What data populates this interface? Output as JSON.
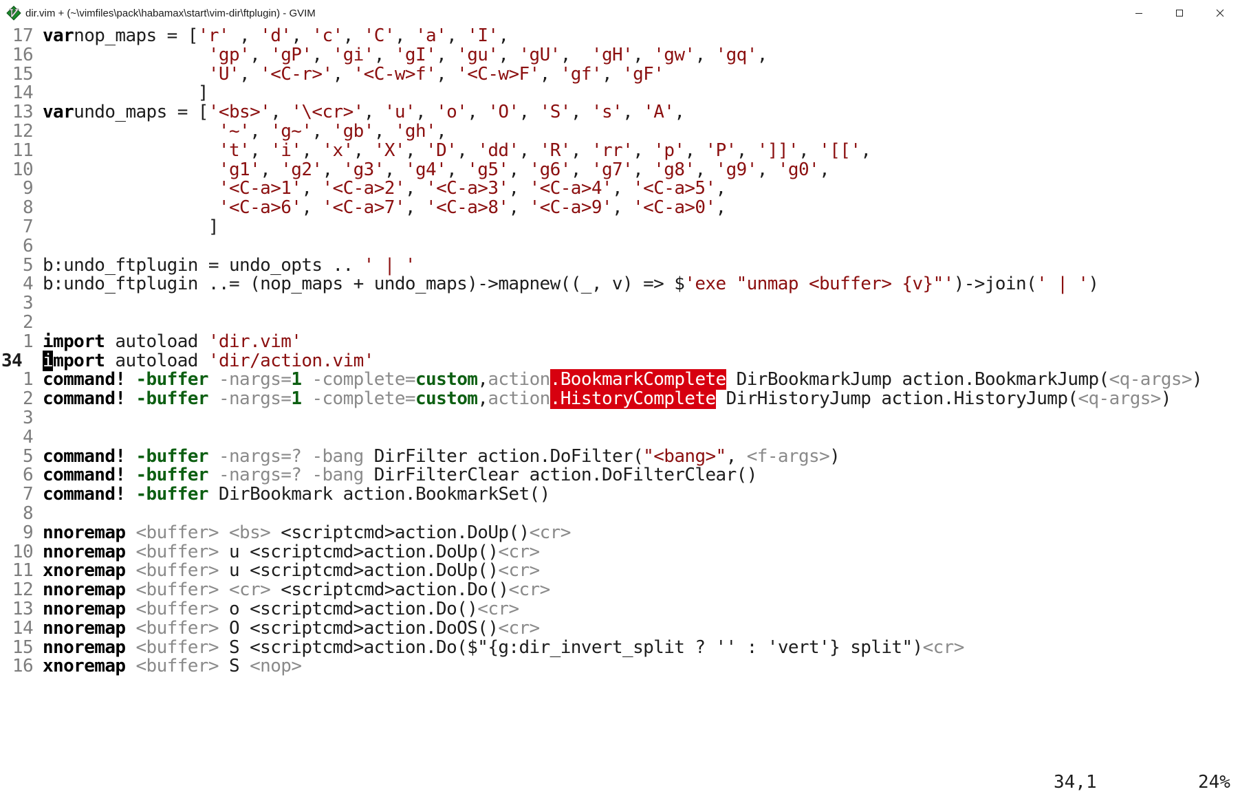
{
  "window": {
    "title": "dir.vim + (~\\vimfiles\\pack\\habamax\\start\\vim-dir\\ftplugin) - GVIM",
    "app_icon": "gvim-icon",
    "controls": [
      "minimize",
      "maximize",
      "close"
    ]
  },
  "editor": {
    "lines": [
      {
        "n": "17",
        "segs": [
          [
            "kw",
            "var"
          ],
          [
            "",
            "nop_maps = ["
          ],
          [
            "str",
            "'r'"
          ],
          [
            "",
            " , "
          ],
          [
            "str",
            "'d'"
          ],
          [
            "",
            ", "
          ],
          [
            "str",
            "'c'"
          ],
          [
            "",
            ", "
          ],
          [
            "str",
            "'C'"
          ],
          [
            "",
            ", "
          ],
          [
            "str",
            "'a'"
          ],
          [
            "",
            ", "
          ],
          [
            "str",
            "'I'"
          ],
          [
            "",
            ","
          ]
        ]
      },
      {
        "n": "16",
        "segs": [
          [
            "",
            "                "
          ],
          [
            "str",
            "'gp'"
          ],
          [
            "",
            ", "
          ],
          [
            "str",
            "'gP'"
          ],
          [
            "",
            ", "
          ],
          [
            "str",
            "'gi'"
          ],
          [
            "",
            ", "
          ],
          [
            "str",
            "'gI'"
          ],
          [
            "",
            ", "
          ],
          [
            "str",
            "'gu'"
          ],
          [
            "",
            ", "
          ],
          [
            "str",
            "'gU'"
          ],
          [
            "",
            ",  "
          ],
          [
            "str",
            "'gH'"
          ],
          [
            "",
            ", "
          ],
          [
            "str",
            "'gw'"
          ],
          [
            "",
            ", "
          ],
          [
            "str",
            "'gq'"
          ],
          [
            "",
            ","
          ]
        ]
      },
      {
        "n": "15",
        "segs": [
          [
            "",
            "                "
          ],
          [
            "str",
            "'U'"
          ],
          [
            "",
            ", "
          ],
          [
            "str",
            "'<C-r>'"
          ],
          [
            "",
            ", "
          ],
          [
            "str",
            "'<C-w>f'"
          ],
          [
            "",
            ", "
          ],
          [
            "str",
            "'<C-w>F'"
          ],
          [
            "",
            ", "
          ],
          [
            "str",
            "'gf'"
          ],
          [
            "",
            ", "
          ],
          [
            "str",
            "'gF'"
          ]
        ]
      },
      {
        "n": "14",
        "segs": [
          [
            "",
            "               ]"
          ]
        ]
      },
      {
        "n": "13",
        "segs": [
          [
            "kw",
            "var"
          ],
          [
            "",
            "undo_maps = ["
          ],
          [
            "str",
            "'<bs>'"
          ],
          [
            "",
            ", "
          ],
          [
            "str",
            "'\\<cr>'"
          ],
          [
            "",
            ", "
          ],
          [
            "str",
            "'u'"
          ],
          [
            "",
            ", "
          ],
          [
            "str",
            "'o'"
          ],
          [
            "",
            ", "
          ],
          [
            "str",
            "'O'"
          ],
          [
            "",
            ", "
          ],
          [
            "str",
            "'S'"
          ],
          [
            "",
            ", "
          ],
          [
            "str",
            "'s'"
          ],
          [
            "",
            ", "
          ],
          [
            "str",
            "'A'"
          ],
          [
            "",
            ","
          ]
        ]
      },
      {
        "n": "12",
        "segs": [
          [
            "",
            "                 "
          ],
          [
            "str",
            "'~'"
          ],
          [
            "",
            ", "
          ],
          [
            "str",
            "'g~'"
          ],
          [
            "",
            ", "
          ],
          [
            "str",
            "'gb'"
          ],
          [
            "",
            ", "
          ],
          [
            "str",
            "'gh'"
          ],
          [
            "",
            ","
          ]
        ]
      },
      {
        "n": "11",
        "segs": [
          [
            "",
            "                 "
          ],
          [
            "str",
            "'t'"
          ],
          [
            "",
            ", "
          ],
          [
            "str",
            "'i'"
          ],
          [
            "",
            ", "
          ],
          [
            "str",
            "'x'"
          ],
          [
            "",
            ", "
          ],
          [
            "str",
            "'X'"
          ],
          [
            "",
            ", "
          ],
          [
            "str",
            "'D'"
          ],
          [
            "",
            ", "
          ],
          [
            "str",
            "'dd'"
          ],
          [
            "",
            ", "
          ],
          [
            "str",
            "'R'"
          ],
          [
            "",
            ", "
          ],
          [
            "str",
            "'rr'"
          ],
          [
            "",
            ", "
          ],
          [
            "str",
            "'p'"
          ],
          [
            "",
            ", "
          ],
          [
            "str",
            "'P'"
          ],
          [
            "",
            ", "
          ],
          [
            "str",
            "']]'"
          ],
          [
            "",
            ", "
          ],
          [
            "str",
            "'[['"
          ],
          [
            "",
            ","
          ]
        ]
      },
      {
        "n": "10",
        "segs": [
          [
            "",
            "                 "
          ],
          [
            "str",
            "'g1'"
          ],
          [
            "",
            ", "
          ],
          [
            "str",
            "'g2'"
          ],
          [
            "",
            ", "
          ],
          [
            "str",
            "'g3'"
          ],
          [
            "",
            ", "
          ],
          [
            "str",
            "'g4'"
          ],
          [
            "",
            ", "
          ],
          [
            "str",
            "'g5'"
          ],
          [
            "",
            ", "
          ],
          [
            "str",
            "'g6'"
          ],
          [
            "",
            ", "
          ],
          [
            "str",
            "'g7'"
          ],
          [
            "",
            ", "
          ],
          [
            "str",
            "'g8'"
          ],
          [
            "",
            ", "
          ],
          [
            "str",
            "'g9'"
          ],
          [
            "",
            ", "
          ],
          [
            "str",
            "'g0'"
          ],
          [
            "",
            ","
          ]
        ]
      },
      {
        "n": "9",
        "segs": [
          [
            "",
            "                 "
          ],
          [
            "str",
            "'<C-a>1'"
          ],
          [
            "",
            ", "
          ],
          [
            "str",
            "'<C-a>2'"
          ],
          [
            "",
            ", "
          ],
          [
            "str",
            "'<C-a>3'"
          ],
          [
            "",
            ", "
          ],
          [
            "str",
            "'<C-a>4'"
          ],
          [
            "",
            ", "
          ],
          [
            "str",
            "'<C-a>5'"
          ],
          [
            "",
            ","
          ]
        ]
      },
      {
        "n": "8",
        "segs": [
          [
            "",
            "                 "
          ],
          [
            "str",
            "'<C-a>6'"
          ],
          [
            "",
            ", "
          ],
          [
            "str",
            "'<C-a>7'"
          ],
          [
            "",
            ", "
          ],
          [
            "str",
            "'<C-a>8'"
          ],
          [
            "",
            ", "
          ],
          [
            "str",
            "'<C-a>9'"
          ],
          [
            "",
            ", "
          ],
          [
            "str",
            "'<C-a>0'"
          ],
          [
            "",
            ","
          ]
        ]
      },
      {
        "n": "7",
        "segs": [
          [
            "",
            "                ]"
          ]
        ]
      },
      {
        "n": "6",
        "segs": []
      },
      {
        "n": "5",
        "segs": [
          [
            "",
            "b:undo_ftplugin = undo_opts .. "
          ],
          [
            "str",
            "' | '"
          ]
        ]
      },
      {
        "n": "4",
        "segs": [
          [
            "",
            "b:undo_ftplugin ..= (nop_maps + undo_maps)->mapnew((_, v) => $"
          ],
          [
            "str",
            "'exe \"unmap <buffer> {v}\"'"
          ],
          [
            "",
            ")->join("
          ],
          [
            "str",
            "' | '"
          ],
          [
            "",
            ")"
          ]
        ]
      },
      {
        "n": "3",
        "segs": []
      },
      {
        "n": "2",
        "segs": []
      },
      {
        "n": "1",
        "segs": [
          [
            "kw",
            "import"
          ],
          [
            "",
            " autoload "
          ],
          [
            "str",
            "'dir.vim'"
          ]
        ]
      },
      {
        "n": "34",
        "current": true,
        "segs": [
          [
            "cursor",
            "i"
          ],
          [
            "kw",
            "mport"
          ],
          [
            "",
            " autoload "
          ],
          [
            "str",
            "'dir/action.vim'"
          ]
        ]
      },
      {
        "n": "1",
        "segs": [
          [
            "kw",
            "command!"
          ],
          [
            "",
            " "
          ],
          [
            "grn",
            "-buffer"
          ],
          [
            "",
            " "
          ],
          [
            "gr",
            "-nargs="
          ],
          [
            "num",
            "1"
          ],
          [
            "",
            " "
          ],
          [
            "gr",
            "-complete="
          ],
          [
            "grn",
            "custom"
          ],
          [
            "",
            ","
          ],
          [
            "gr",
            "action"
          ],
          [
            "err",
            ".BookmarkComplete"
          ],
          [
            "",
            " DirBookmarkJump action.BookmarkJump("
          ],
          [
            "gr",
            "<q-args>"
          ],
          [
            "",
            ")"
          ]
        ]
      },
      {
        "n": "2",
        "segs": [
          [
            "kw",
            "command!"
          ],
          [
            "",
            " "
          ],
          [
            "grn",
            "-buffer"
          ],
          [
            "",
            " "
          ],
          [
            "gr",
            "-nargs="
          ],
          [
            "num",
            "1"
          ],
          [
            "",
            " "
          ],
          [
            "gr",
            "-complete="
          ],
          [
            "grn",
            "custom"
          ],
          [
            "",
            ","
          ],
          [
            "gr",
            "action"
          ],
          [
            "err",
            ".HistoryComplete"
          ],
          [
            "",
            " DirHistoryJump action.HistoryJump("
          ],
          [
            "gr",
            "<q-args>"
          ],
          [
            "",
            ")"
          ]
        ]
      },
      {
        "n": "3",
        "segs": []
      },
      {
        "n": "4",
        "segs": []
      },
      {
        "n": "5",
        "segs": [
          [
            "kw",
            "command!"
          ],
          [
            "",
            " "
          ],
          [
            "grn",
            "-buffer"
          ],
          [
            "",
            " "
          ],
          [
            "gr",
            "-nargs=?"
          ],
          [
            "",
            " "
          ],
          [
            "gr",
            "-bang"
          ],
          [
            "",
            " DirFilter action.DoFilter("
          ],
          [
            "str",
            "\"<bang>\""
          ],
          [
            "",
            ", "
          ],
          [
            "gr",
            "<f-args>"
          ],
          [
            "",
            ")"
          ]
        ]
      },
      {
        "n": "6",
        "segs": [
          [
            "kw",
            "command!"
          ],
          [
            "",
            " "
          ],
          [
            "grn",
            "-buffer"
          ],
          [
            "",
            " "
          ],
          [
            "gr",
            "-nargs=?"
          ],
          [
            "",
            " "
          ],
          [
            "gr",
            "-bang"
          ],
          [
            "",
            " DirFilterClear action.DoFilterClear()"
          ]
        ]
      },
      {
        "n": "7",
        "segs": [
          [
            "kw",
            "command!"
          ],
          [
            "",
            " "
          ],
          [
            "grn",
            "-buffer"
          ],
          [
            "",
            " DirBookmark action.BookmarkSet()"
          ]
        ]
      },
      {
        "n": "8",
        "segs": []
      },
      {
        "n": "9",
        "segs": [
          [
            "kw",
            "nnoremap"
          ],
          [
            "",
            " "
          ],
          [
            "gr",
            "<buffer>"
          ],
          [
            "",
            " "
          ],
          [
            "gr",
            "<bs>"
          ],
          [
            "",
            " <scriptcmd>action.DoUp()"
          ],
          [
            "gr",
            "<cr>"
          ]
        ]
      },
      {
        "n": "10",
        "segs": [
          [
            "kw",
            "nnoremap"
          ],
          [
            "",
            " "
          ],
          [
            "gr",
            "<buffer>"
          ],
          [
            "",
            " u <scriptcmd>action.DoUp()"
          ],
          [
            "gr",
            "<cr>"
          ]
        ]
      },
      {
        "n": "11",
        "segs": [
          [
            "kw",
            "xnoremap"
          ],
          [
            "",
            " "
          ],
          [
            "gr",
            "<buffer>"
          ],
          [
            "",
            " u <scriptcmd>action.DoUp()"
          ],
          [
            "gr",
            "<cr>"
          ]
        ]
      },
      {
        "n": "12",
        "segs": [
          [
            "kw",
            "nnoremap"
          ],
          [
            "",
            " "
          ],
          [
            "gr",
            "<buffer>"
          ],
          [
            "",
            " "
          ],
          [
            "gr",
            "<cr>"
          ],
          [
            "",
            " <scriptcmd>action.Do()"
          ],
          [
            "gr",
            "<cr>"
          ]
        ]
      },
      {
        "n": "13",
        "segs": [
          [
            "kw",
            "nnoremap"
          ],
          [
            "",
            " "
          ],
          [
            "gr",
            "<buffer>"
          ],
          [
            "",
            " o <scriptcmd>action.Do()"
          ],
          [
            "gr",
            "<cr>"
          ]
        ]
      },
      {
        "n": "14",
        "segs": [
          [
            "kw",
            "nnoremap"
          ],
          [
            "",
            " "
          ],
          [
            "gr",
            "<buffer>"
          ],
          [
            "",
            " O <scriptcmd>action.DoOS()"
          ],
          [
            "gr",
            "<cr>"
          ]
        ]
      },
      {
        "n": "15",
        "segs": [
          [
            "kw",
            "nnoremap"
          ],
          [
            "",
            " "
          ],
          [
            "gr",
            "<buffer>"
          ],
          [
            "",
            " S <scriptcmd>action.Do($\"{g:dir_invert_split ? '' : 'vert'} split\")"
          ],
          [
            "gr",
            "<cr>"
          ]
        ]
      },
      {
        "n": "16",
        "segs": [
          [
            "kw",
            "xnoremap"
          ],
          [
            "",
            " "
          ],
          [
            "gr",
            "<buffer>"
          ],
          [
            "",
            " S "
          ],
          [
            "gr",
            "<nop>"
          ]
        ]
      }
    ]
  },
  "status": {
    "position": "34,1",
    "percent": "24%"
  }
}
